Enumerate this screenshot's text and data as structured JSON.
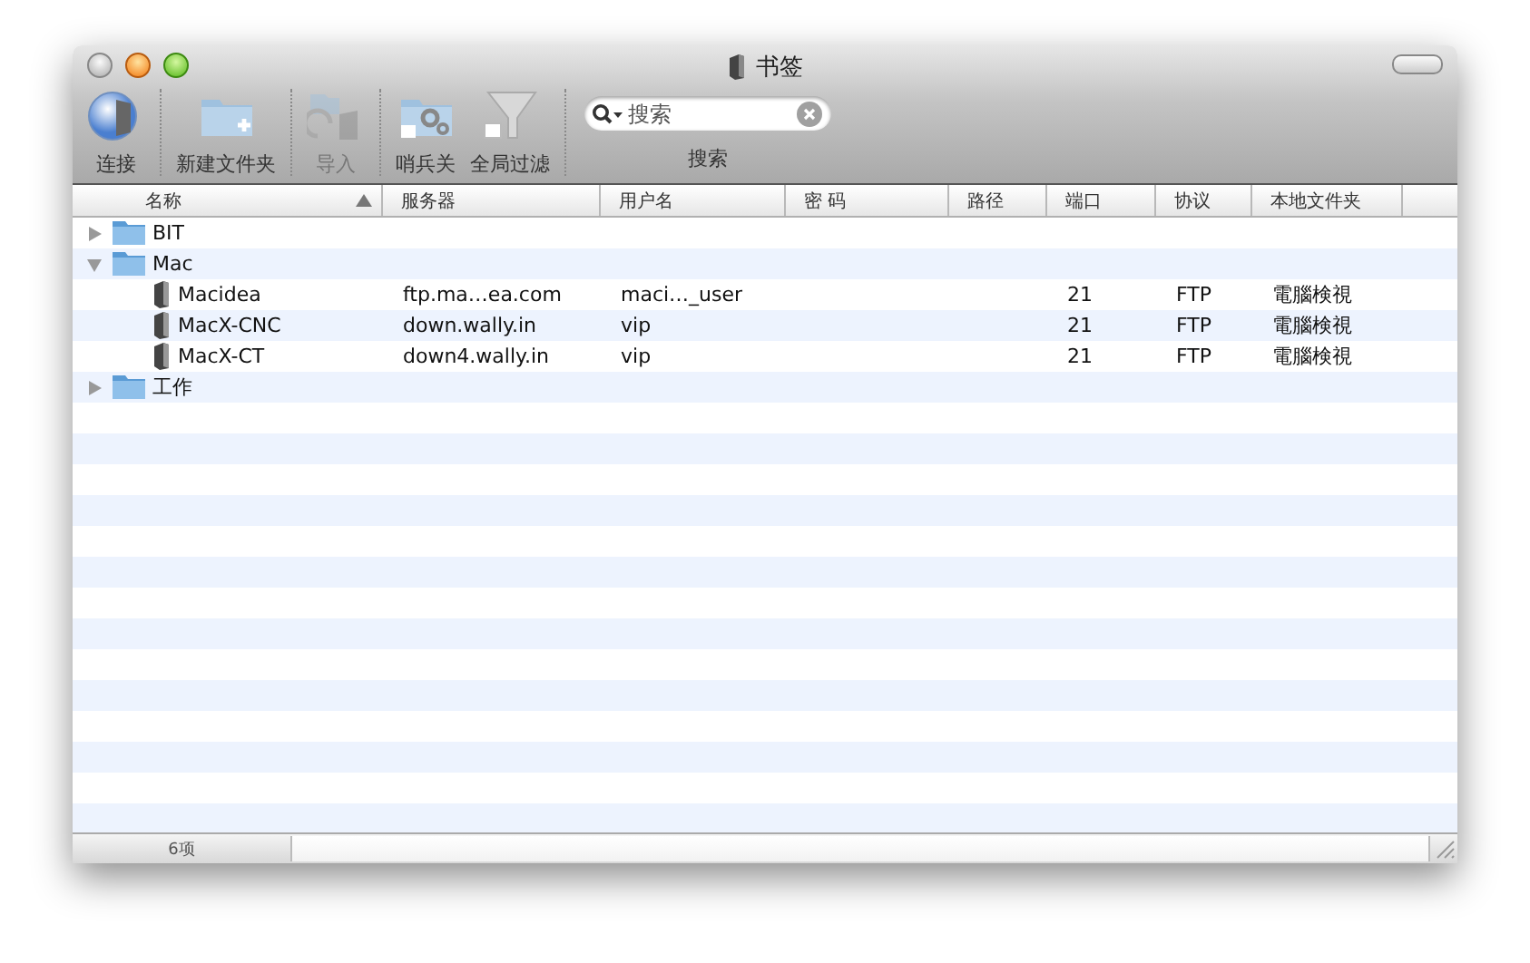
{
  "window": {
    "title": "书签"
  },
  "toolbar": {
    "groups": [
      [
        {
          "label": "连接",
          "disabled": false
        }
      ],
      [
        {
          "label": "新建文件夹",
          "disabled": false
        }
      ],
      [
        {
          "label": "导入",
          "disabled": true
        }
      ],
      [
        {
          "label": "哨兵关",
          "disabled": false
        },
        {
          "label": "全局过滤",
          "disabled": false
        }
      ]
    ],
    "search": {
      "placeholder": "搜索",
      "label": "搜索"
    }
  },
  "table": {
    "columns": [
      {
        "label": "名称",
        "sorted": true
      },
      {
        "label": "服务器",
        "sorted": false
      },
      {
        "label": "用户名",
        "sorted": false
      },
      {
        "label": "密 码",
        "sorted": false
      },
      {
        "label": "路径",
        "sorted": false
      },
      {
        "label": "端口",
        "sorted": false
      },
      {
        "label": "协议",
        "sorted": false
      },
      {
        "label": "本地文件夹",
        "sorted": false
      }
    ],
    "rows": [
      {
        "kind": "folder",
        "name": "BIT",
        "expanded": false
      },
      {
        "kind": "folder",
        "name": "Mac",
        "expanded": true,
        "children": [
          {
            "kind": "bookmark",
            "name": "Macidea",
            "server": "ftp.ma…ea.com",
            "user": "maci…_user",
            "port": "21",
            "protocol": "FTP",
            "local": "電腦検視"
          },
          {
            "kind": "bookmark",
            "name": "MacX-CNC",
            "server": "down.wally.in",
            "user": "vip",
            "port": "21",
            "protocol": "FTP",
            "local": "電腦検視"
          },
          {
            "kind": "bookmark",
            "name": "MacX-CT",
            "server": "down4.wally.in",
            "user": "vip",
            "port": "21",
            "protocol": "FTP",
            "local": "電腦検視"
          }
        ]
      },
      {
        "kind": "folder",
        "name": "工作",
        "expanded": false
      }
    ]
  },
  "status_bar": {
    "count": "6项"
  }
}
